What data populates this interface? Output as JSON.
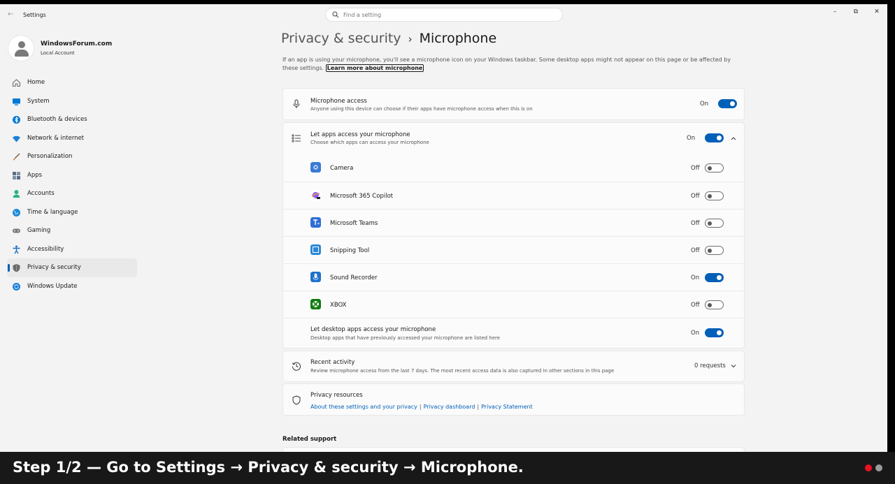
{
  "window": {
    "title": "Settings",
    "search_placeholder": "Find a setting",
    "buttons": {
      "minimize": "–",
      "restore": "⧉",
      "close": "✕"
    }
  },
  "profile": {
    "name": "WindowsForum.com",
    "account": "Local Account"
  },
  "sidebar": {
    "items": [
      {
        "label": "Home",
        "icon": "home-icon",
        "color": "#6b6b6b"
      },
      {
        "label": "System",
        "icon": "system-icon",
        "color": "#0078d4"
      },
      {
        "label": "Bluetooth & devices",
        "icon": "bluetooth-icon",
        "color": "#0078d4"
      },
      {
        "label": "Network & internet",
        "icon": "wifi-icon",
        "color": "#1b7fd6"
      },
      {
        "label": "Personalization",
        "icon": "brush-icon",
        "color": "#d67a3a"
      },
      {
        "label": "Apps",
        "icon": "apps-icon",
        "color": "#5a6b87"
      },
      {
        "label": "Accounts",
        "icon": "person-icon",
        "color": "#2bb37d"
      },
      {
        "label": "Time & language",
        "icon": "globe-icon",
        "color": "#1b8bd6"
      },
      {
        "label": "Gaming",
        "icon": "gamepad-icon",
        "color": "#7a7a7a"
      },
      {
        "label": "Accessibility",
        "icon": "accessibility-icon",
        "color": "#1b6fc4"
      },
      {
        "label": "Privacy & security",
        "icon": "shield-icon",
        "color": "#6b6b6b"
      },
      {
        "label": "Windows Update",
        "icon": "update-icon",
        "color": "#1b7fd6"
      }
    ],
    "active": "Privacy & security"
  },
  "breadcrumb": {
    "parent": "Privacy & security",
    "separator": "›",
    "current": "Microphone"
  },
  "intro": {
    "text": "If an app is using your microphone, you'll see a microphone icon on your Windows taskbar. Some desktop apps might not appear on this page or be affected by these settings. ",
    "link": "Learn more about microphone"
  },
  "microphone_access": {
    "title": "Microphone access",
    "subtitle": "Anyone using this device can choose if their apps have microphone access when this is on",
    "state": "On"
  },
  "let_apps": {
    "title": "Let apps access your microphone",
    "subtitle": "Choose which apps can access your microphone",
    "state": "On"
  },
  "apps": [
    {
      "name": "Camera",
      "state": "Off",
      "icon": "camera-app-icon",
      "color": "#3a7bd5"
    },
    {
      "name": "Microsoft 365 Copilot",
      "state": "Off",
      "icon": "copilot-app-icon",
      "color": "#8a5cf6"
    },
    {
      "name": "Microsoft Teams",
      "state": "Off",
      "icon": "teams-app-icon",
      "color": "#2f6fd6"
    },
    {
      "name": "Snipping Tool",
      "state": "Off",
      "icon": "snipping-app-icon",
      "color": "#2b88d8"
    },
    {
      "name": "Sound Recorder",
      "state": "On",
      "icon": "recorder-app-icon",
      "color": "#1f72c9"
    },
    {
      "name": "XBOX",
      "state": "Off",
      "icon": "xbox-app-icon",
      "color": "#107c10"
    }
  ],
  "desktop_apps": {
    "title": "Let desktop apps access your microphone",
    "subtitle": "Desktop apps that have previously accessed your microphone are listed here",
    "state": "On"
  },
  "recent_activity": {
    "title": "Recent activity",
    "subtitle": "Review microphone access from the last 7 days. The most recent access data is also captured in other sections in this page",
    "value": "0 requests"
  },
  "privacy_resources": {
    "title": "Privacy resources",
    "links": [
      "About these settings and your privacy",
      "Privacy dashboard",
      "Privacy Statement"
    ],
    "separator": "|"
  },
  "related_support": {
    "title": "Related support"
  },
  "caption": {
    "text": "Step 1/2 — Go to Settings → Privacy & security → Microphone."
  },
  "colors": {
    "accent": "#005fb8",
    "dot_active": "#e81123",
    "dot_inactive": "#9a9a9a"
  }
}
